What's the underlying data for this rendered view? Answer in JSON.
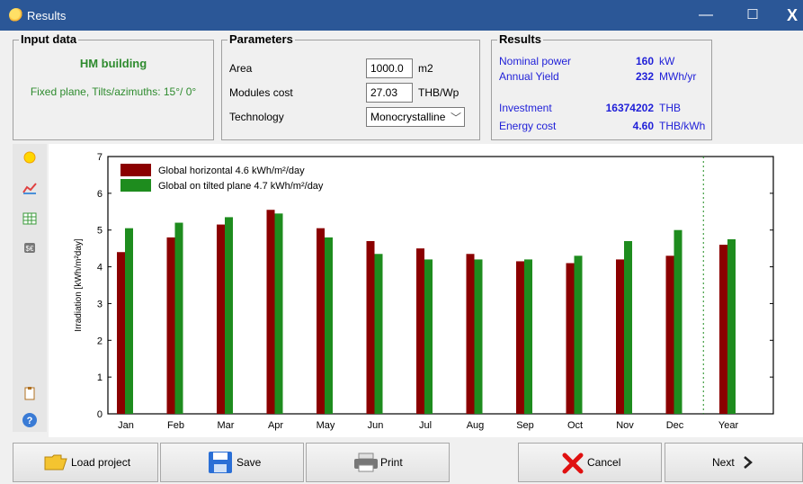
{
  "window": {
    "title": "Results",
    "minimize": "—",
    "maximize": "☐",
    "close": "X"
  },
  "input": {
    "title": "Input data",
    "building": "HM building",
    "plane": "Fixed plane, Tilts/azimuths: 15°/ 0°"
  },
  "params": {
    "title": "Parameters",
    "area_label": "Area",
    "area_value": "1000.0",
    "area_unit": "m2",
    "cost_label": "Modules cost",
    "cost_value": "27.03",
    "cost_unit": "THB/Wp",
    "tech_label": "Technology",
    "tech_value": "Monocrystalline"
  },
  "results": {
    "title": "Results",
    "power_label": "Nominal power",
    "power_value": "160",
    "power_unit": "kW",
    "yield_label": "Annual Yield",
    "yield_value": "232",
    "yield_unit": "MWh/yr",
    "investment_label": "Investment",
    "investment_value": "16374202",
    "investment_unit": "THB",
    "energy_label": "Energy cost",
    "energy_value": "4.60",
    "energy_unit": "THB/kWh"
  },
  "toolbar": [
    "sun-icon",
    "chart-icon",
    "table-icon",
    "money-icon",
    "clipboard-icon",
    "help-icon"
  ],
  "chart_data": {
    "type": "bar",
    "categories": [
      "Jan",
      "Feb",
      "Mar",
      "Apr",
      "May",
      "Jun",
      "Jul",
      "Aug",
      "Sep",
      "Oct",
      "Nov",
      "Dec",
      "Year"
    ],
    "series": [
      {
        "name": "Global horizontal   4.6 kWh/m²/day",
        "color": "#8b0000",
        "values": [
          4.4,
          4.8,
          5.15,
          5.55,
          5.05,
          4.7,
          4.5,
          4.35,
          4.15,
          4.1,
          4.2,
          4.3,
          4.6
        ]
      },
      {
        "name": "Global on tilted plane   4.7 kWh/m²/day",
        "color": "#1e8c1e",
        "values": [
          5.05,
          5.2,
          5.35,
          5.45,
          4.8,
          4.35,
          4.2,
          4.2,
          4.2,
          4.3,
          4.7,
          5.0,
          4.75
        ]
      }
    ],
    "ylabel": "Irradiation [kWh/m²day]",
    "ylim": [
      0,
      7
    ],
    "yticks": [
      "0",
      "1",
      "2",
      "3",
      "4",
      "5",
      "6",
      "7"
    ],
    "legend": "top-left"
  },
  "buttons": {
    "load": "Load project",
    "save": "Save",
    "print": "Print",
    "cancel": "Cancel",
    "next": "Next"
  }
}
